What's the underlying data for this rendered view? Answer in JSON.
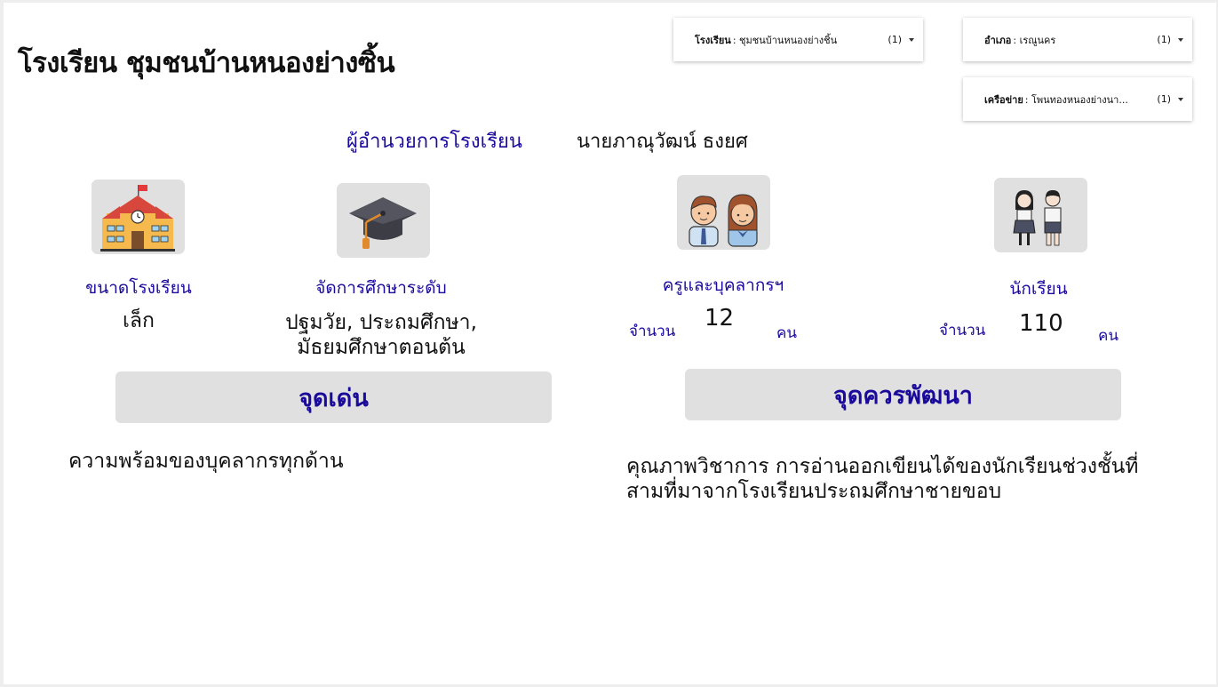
{
  "page": {
    "title": "โรงเรียน ชุมชนบ้านหนองย่างซิ้น"
  },
  "filters": [
    {
      "label": "โรงเรียน",
      "value": ": ชุมชนบ้านหนองย่างชิ้น",
      "count": "(1)",
      "icon": "chevron-down-icon"
    },
    {
      "label": "อำเภอ",
      "value": ": เรณูนคร",
      "count": "(1)",
      "icon": "chevron-down-icon"
    },
    {
      "label": "เครือข่าย",
      "value": ": โพนทองหนองย่างนา...",
      "count": "(1)",
      "icon": "chevron-down-icon"
    }
  ],
  "director": {
    "label": "ผู้อำนวยการโรงเรียน",
    "name": "นายภาณุวัฒน์ ธงยศ"
  },
  "school_size": {
    "label": "ขนาดโรงเรียน",
    "value": "เล็ก",
    "icon": "school-building-icon"
  },
  "education_level": {
    "label": "จัดการศึกษาระดับ",
    "value": "ปฐมวัย, ประถมศึกษา, มัธยมศึกษาตอนต้น",
    "icon": "graduation-cap-icon"
  },
  "teachers": {
    "label": "ครูและบุคลากรฯ",
    "count_prefix": "จำนวน",
    "count": "12",
    "unit": "คน",
    "icon": "teachers-icon"
  },
  "students": {
    "label": "นักเรียน",
    "count_prefix": "จำนวน",
    "count": "110",
    "unit": "คน",
    "icon": "students-icon"
  },
  "strengths": {
    "heading": "จุดเด่น",
    "text": "ความพร้อมของบุคลากรทุกด้าน"
  },
  "improvements": {
    "heading": "จุดควรพัฒนา",
    "text": "คุณภาพวิชาการ การอ่านออกเขียนได้ของนักเรียนช่วงชั้นที่สามที่มาจากโรงเรียนประถมศึกษาชายขอบ"
  },
  "colors": {
    "accent_blue": "#1a0a9b",
    "panel_gray": "#e0e0e0"
  }
}
